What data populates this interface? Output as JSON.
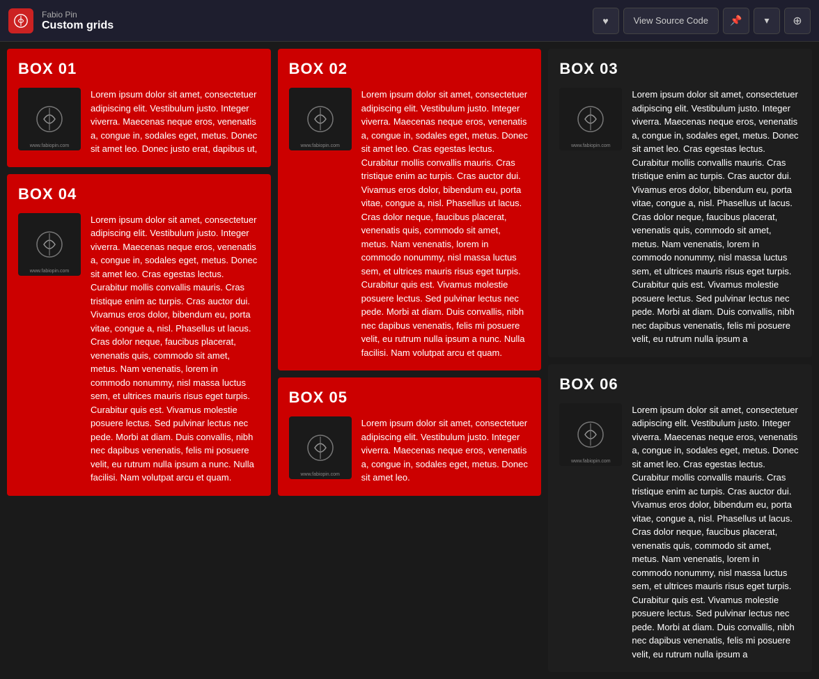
{
  "header": {
    "logo_alt": "Fabio Pin Logo",
    "username": "Fabio Pin",
    "title": "Custom grids",
    "heart_btn": "♥",
    "view_source_btn": "View Source Code",
    "pin_btn": "📌",
    "chevron_btn": "▾",
    "link_btn": "⊕"
  },
  "boxes": [
    {
      "id": "box01",
      "title": "BOX 01",
      "text": "Lorem ipsum dolor sit amet, consectetuer adipiscing elit. Vestibulum justo. Integer viverra. Maecenas neque eros, venenatis a, congue in, sodales eget, metus. Donec sit amet leo. Donec justo erat, dapibus ut,"
    },
    {
      "id": "box02",
      "title": "BOX 02",
      "text": "Lorem ipsum dolor sit amet, consectetuer adipiscing elit. Vestibulum justo. Integer viverra. Maecenas neque eros, venenatis a, congue in, sodales eget, metus. Donec sit amet leo. Cras egestas lectus. Curabitur mollis convallis mauris. Cras tristique enim ac turpis. Cras auctor dui. Vivamus eros dolor, bibendum eu, porta vitae, congue a, nisl. Phasellus ut lacus. Cras dolor neque, faucibus placerat, venenatis quis, commodo sit amet, metus. Nam venenatis, lorem in commodo nonummy, nisl massa luctus sem, et ultrices mauris risus eget turpis. Curabitur quis est. Vivamus molestie posuere lectus. Sed pulvinar lectus nec pede. Morbi at diam. Duis convallis, nibh nec dapibus venenatis, felis mi posuere velit, eu rutrum nulla ipsum a nunc. Nulla facilisi. Nam volutpat arcu et quam."
    },
    {
      "id": "box03",
      "title": "BOX 03",
      "text": "Lorem ipsum dolor sit amet, consectetuer adipiscing elit. Vestibulum justo. Integer viverra. Maecenas neque eros, venenatis a, congue in, sodales eget, metus. Donec sit amet leo. Cras egestas lectus. Curabitur mollis convallis mauris. Cras tristique enim ac turpis. Cras auctor dui. Vivamus eros dolor, bibendum eu, porta vitae, congue a, nisl. Phasellus ut lacus. Cras dolor neque, faucibus placerat, venenatis quis, commodo sit amet, metus. Nam venenatis, lorem in commodo nonummy, nisl massa luctus sem, et ultrices mauris risus eget turpis. Curabitur quis est. Vivamus molestie posuere lectus. Sed pulvinar lectus nec pede. Morbi at diam. Duis convallis, nibh nec dapibus venenatis, felis mi posuere velit, eu rutrum nulla ipsum a"
    },
    {
      "id": "box04",
      "title": "BOX 04",
      "text": "Lorem ipsum dolor sit amet, consectetuer adipiscing elit. Vestibulum justo. Integer viverra. Maecenas neque eros, venenatis a, congue in, sodales eget, metus. Donec sit amet leo. Cras egestas lectus. Curabitur mollis convallis mauris. Cras tristique enim ac turpis. Cras auctor dui. Vivamus eros dolor, bibendum eu, porta vitae, congue a, nisl. Phasellus ut lacus. Cras dolor neque, faucibus placerat, venenatis quis, commodo sit amet, metus. Nam venenatis, lorem in commodo nonummy, nisl massa luctus sem, et ultrices mauris risus eget turpis. Curabitur quis est. Vivamus molestie posuere lectus. Sed pulvinar lectus nec pede. Morbi at diam. Duis convallis, nibh nec dapibus venenatis, felis mi posuere velit, eu rutrum nulla ipsum a nunc. Nulla facilisi. Nam volutpat arcu et quam."
    },
    {
      "id": "box05",
      "title": "BOX 05",
      "text": "Lorem ipsum dolor sit amet, consectetuer adipiscing elit. Vestibulum justo. Integer viverra. Maecenas neque eros, venenatis a, congue in, sodales eget, metus. Donec sit amet leo."
    },
    {
      "id": "box06",
      "title": "BOX 06",
      "text": "Lorem ipsum dolor sit amet, consectetuer adipiscing elit. Vestibulum justo. Integer viverra. Maecenas neque eros, venenatis a, congue in, sodales eget, metus. Donec sit amet leo. Cras egestas lectus. Curabitur mollis convallis mauris. Cras tristique enim ac turpis. Cras auctor dui. Vivamus eros dolor, bibendum eu, porta vitae, congue a, nisl. Phasellus ut lacus. Cras dolor neque, faucibus placerat, venenatis quis, commodo sit amet, metus. Nam venenatis, lorem in commodo nonummy, nisl massa luctus sem, et ultrices mauris risus eget turpis. Curabitur quis est. Vivamus molestie posuere lectus. Sed pulvinar lectus nec pede. Morbi at diam. Duis convallis, nibh nec dapibus venenatis, felis mi posuere velit, eu rutrum nulla ipsum a"
    }
  ],
  "image_label": "www.fabiopin.com"
}
